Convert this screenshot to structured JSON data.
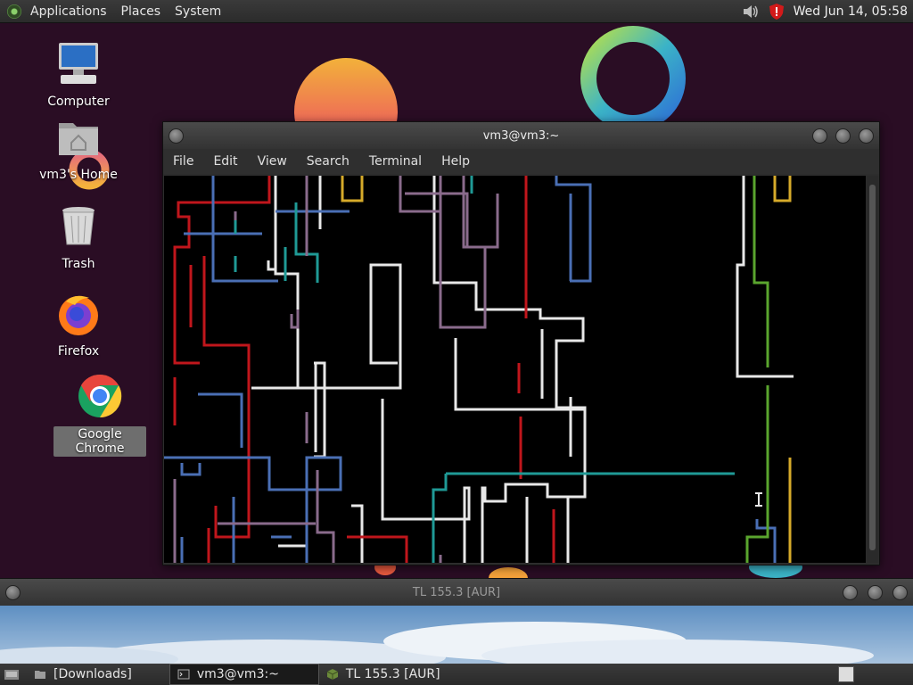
{
  "top_panel": {
    "menus": [
      "Applications",
      "Places",
      "System"
    ],
    "clock": "Wed Jun 14, 05:58"
  },
  "desktop_icons": [
    {
      "label": "Computer",
      "icon": "computer-icon"
    },
    {
      "label": "vm3's Home",
      "icon": "home-folder-icon"
    },
    {
      "label": "Trash",
      "icon": "trash-icon"
    },
    {
      "label": "Firefox",
      "icon": "firefox-icon"
    },
    {
      "label": "Google Chrome",
      "icon": "chrome-icon"
    }
  ],
  "terminal": {
    "title": "vm3@vm3:~",
    "menu": [
      "File",
      "Edit",
      "View",
      "Search",
      "Terminal",
      "Help"
    ]
  },
  "tl_window": {
    "title": "TL 155.3 [AUR]"
  },
  "taskbar": {
    "items": [
      {
        "label": "[Downloads]",
        "icon": "folder-icon"
      },
      {
        "label": "vm3@vm3:~",
        "icon": "terminal-icon"
      },
      {
        "label": "TL 155.3 [AUR]",
        "icon": "cube-icon"
      }
    ]
  },
  "colors": {
    "pipe_white": "#e8e8e8",
    "pipe_red": "#c0161c",
    "pipe_blue": "#4a6fb5",
    "pipe_teal": "#1f9a96",
    "pipe_purple": "#8a6b8c",
    "pipe_green": "#5aa52e",
    "pipe_yellow": "#d6aa2a"
  }
}
